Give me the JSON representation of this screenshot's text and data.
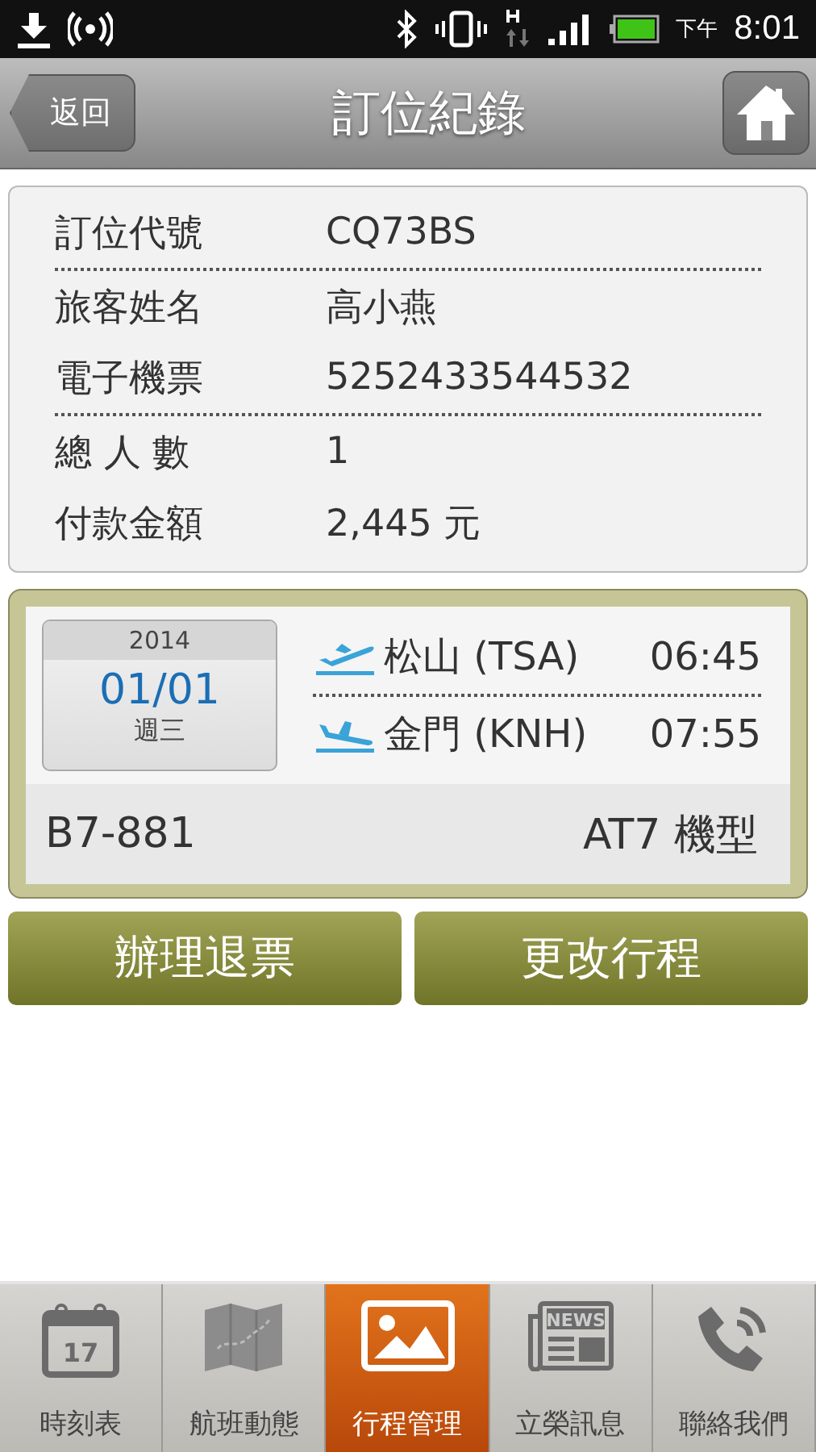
{
  "status_bar": {
    "time": "8:01",
    "ampm": "下午"
  },
  "header": {
    "back": "返回",
    "title": "訂位紀錄"
  },
  "info": [
    {
      "label": "訂位代號",
      "value": "CQ73BS",
      "divider_after": true
    },
    {
      "label": "旅客姓名",
      "value": "高小燕",
      "divider_after": false
    },
    {
      "label": "電子機票",
      "value": "5252433544532",
      "divider_after": true
    },
    {
      "label": "總 人 數",
      "value": "1",
      "divider_after": false
    },
    {
      "label": "付款金額",
      "value": "2,445 元",
      "divider_after": false
    }
  ],
  "flight": {
    "year": "2014",
    "date": "01/01",
    "weekday": "週三",
    "legs": [
      {
        "kind": "departure",
        "airport": "松山 (TSA)",
        "time": "06:45"
      },
      {
        "kind": "arrival",
        "airport": "金門 (KNH)",
        "time": "07:55"
      }
    ],
    "flight_no": "B7-881",
    "aircraft": "AT7  機型"
  },
  "actions": [
    "辦理退票",
    "更改行程"
  ],
  "tabs": [
    {
      "kind": "calendar",
      "icon_text": "17",
      "label": "時刻表",
      "selected": false
    },
    {
      "kind": "map",
      "label": "航班動態",
      "selected": false
    },
    {
      "kind": "picture",
      "label": "行程管理",
      "selected": true
    },
    {
      "kind": "news",
      "icon_text": "NEWS",
      "label": "立榮訊息",
      "selected": false
    },
    {
      "kind": "phone",
      "label": "聯絡我們",
      "selected": false
    }
  ]
}
